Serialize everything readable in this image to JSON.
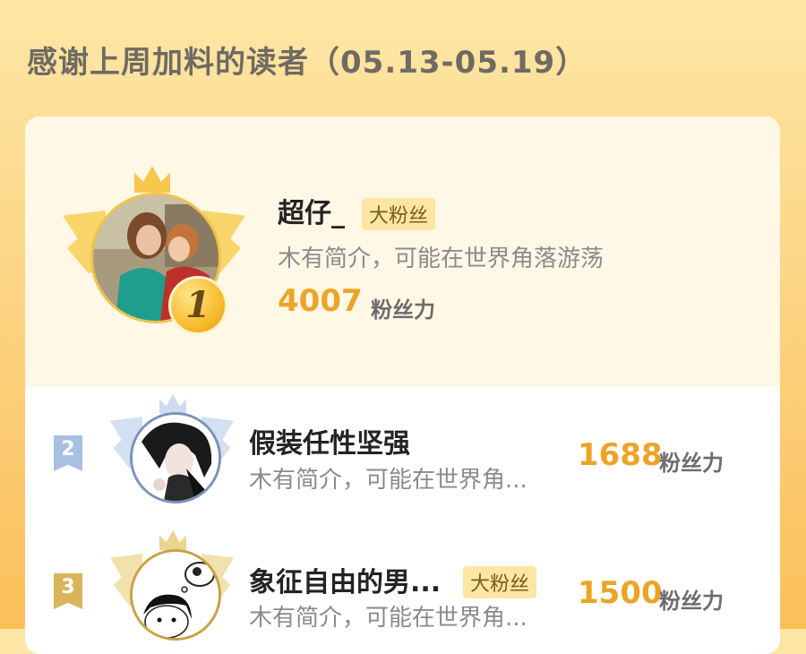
{
  "page": {
    "title": "感谢上周加料的读者（05.13-05.19）"
  },
  "ranking": [
    {
      "rank": "1",
      "name": "超仔_",
      "badge": "大粉丝",
      "bio": "木有简介，可能在世界角落游荡",
      "score": "4007",
      "unit": "粉丝力"
    },
    {
      "rank": "2",
      "name": "假装任性坚强",
      "badge": "",
      "bio": "木有简介，可能在世界角...",
      "score": "1688",
      "unit": "粉丝力"
    },
    {
      "rank": "3",
      "name": "象征自由的男...",
      "badge": "大粉丝",
      "bio": "木有简介，可能在世界角...",
      "score": "1500",
      "unit": "粉丝力"
    }
  ],
  "colors": {
    "accent": "#eca427",
    "rank2": "#9fb8dc",
    "rank3": "#d9b45a"
  }
}
